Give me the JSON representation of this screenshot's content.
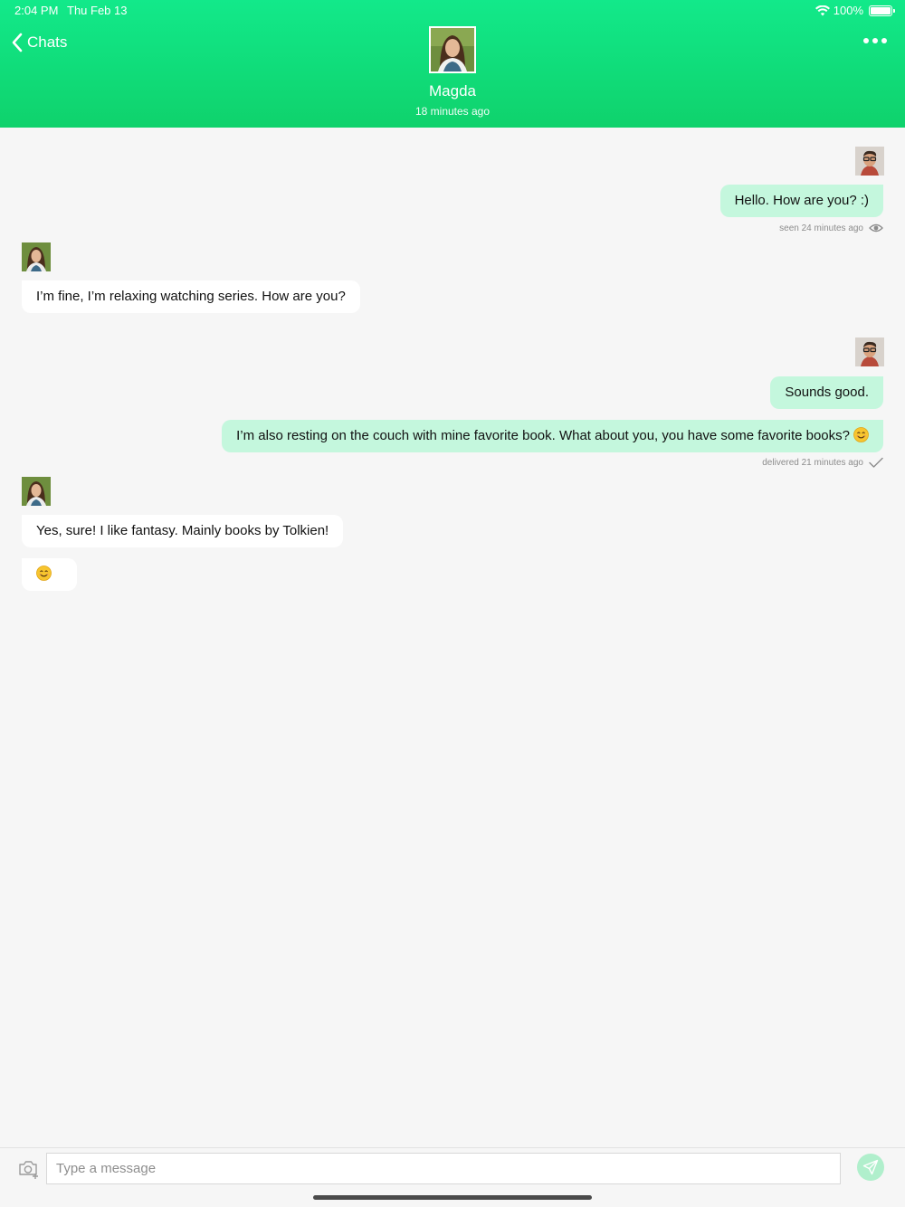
{
  "status_bar": {
    "time": "2:04 PM",
    "date": "Thu Feb 13",
    "battery": "100%"
  },
  "header": {
    "back_label": "Chats",
    "contact_name": "Magda",
    "contact_status": "18 minutes ago",
    "icons": {
      "back": "chevron-left-icon",
      "more": "more-horizontal-icon"
    }
  },
  "colors": {
    "header_gradient_top": "#12e98a",
    "header_gradient_bottom": "#0fd26c",
    "outgoing_bubble": "#c4f7dd",
    "incoming_bubble": "#ffffff",
    "background": "#f6f6f6"
  },
  "messages": [
    {
      "direction": "out",
      "text": "Hello. How are you? :)",
      "meta": "seen 24 minutes ago",
      "meta_icon": "eye-icon"
    },
    {
      "direction": "in",
      "text": "I’m fine, I’m relaxing watching series. How are you?"
    },
    {
      "direction": "out",
      "text": "Sounds good."
    },
    {
      "direction": "out",
      "text": "I’m also resting on the couch with mine favorite book. What about you, you have some favorite books?",
      "emoji": "smiling-face-emoji",
      "meta": "delivered 21 minutes ago",
      "meta_icon": "checkmark-icon"
    },
    {
      "direction": "in",
      "text": "Yes, sure! I like fantasy. Mainly books by Tolkien!"
    },
    {
      "direction": "in",
      "text": "",
      "emoji": "smiling-face-emoji"
    }
  ],
  "composer": {
    "placeholder": "Type a message",
    "value": "",
    "icons": {
      "camera": "camera-add-icon",
      "send": "send-icon"
    }
  }
}
